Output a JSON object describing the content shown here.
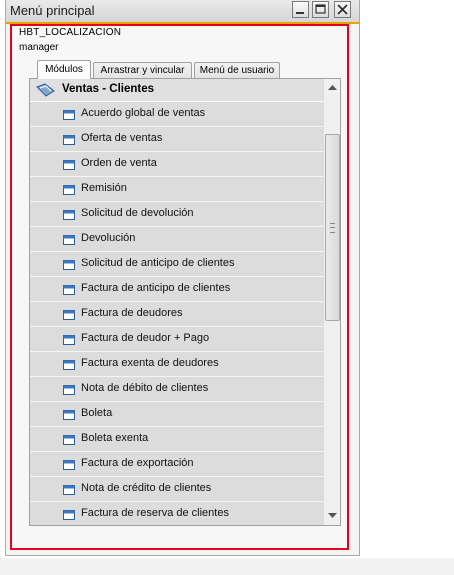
{
  "window": {
    "title": "Menú principal"
  },
  "company": "HBT_LOCALIZACION",
  "user": "manager",
  "tabs": [
    {
      "label": "Módulos",
      "active": true
    },
    {
      "label": "Arrastrar y vincular",
      "active": false
    },
    {
      "label": "Menú de usuario",
      "active": false
    }
  ],
  "section": {
    "label": "Ventas - Clientes",
    "icon": "sales-folder-icon"
  },
  "items": [
    {
      "label": "Acuerdo global de ventas"
    },
    {
      "label": "Oferta de ventas"
    },
    {
      "label": "Orden de venta"
    },
    {
      "label": "Remisión"
    },
    {
      "label": "Solicitud de devolución"
    },
    {
      "label": "Devolución"
    },
    {
      "label": "Solicitud de anticipo de clientes"
    },
    {
      "label": "Factura de anticipo de clientes"
    },
    {
      "label": "Factura de deudores"
    },
    {
      "label": "Factura de deudor + Pago"
    },
    {
      "label": "Factura exenta de deudores"
    },
    {
      "label": "Nota de débito de clientes"
    },
    {
      "label": "Boleta"
    },
    {
      "label": "Boleta exenta"
    },
    {
      "label": "Factura de exportación"
    },
    {
      "label": "Nota de crédito de clientes"
    },
    {
      "label": "Factura de reserva de clientes"
    }
  ],
  "colors": {
    "highlight_frame": "#e3001b",
    "title_underline": "#e2a400",
    "row_bg": "#dcdcdc"
  }
}
